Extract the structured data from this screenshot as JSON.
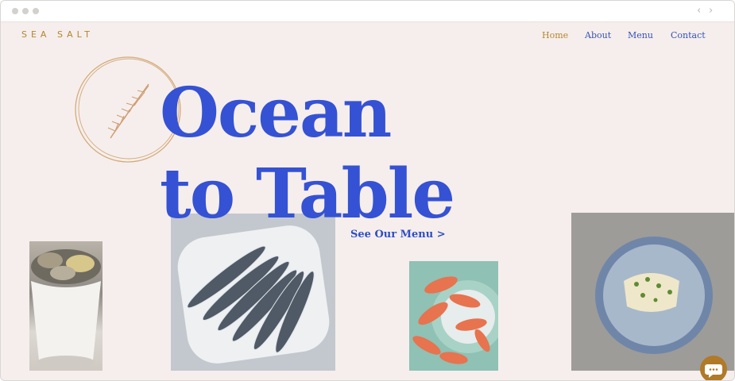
{
  "brand": {
    "logo": "SEA SALT"
  },
  "nav": {
    "items": [
      {
        "label": "Home"
      },
      {
        "label": "About"
      },
      {
        "label": "Menu"
      },
      {
        "label": "Contact"
      }
    ]
  },
  "hero": {
    "line1": "Ocean",
    "line2": "to Table",
    "cta": "See Our Menu >"
  },
  "colors": {
    "accent_gold": "#b3862f",
    "headline_blue": "#3552d4",
    "background": "#f6eeec"
  },
  "icons": [
    "chevron-left-icon",
    "chevron-right-icon",
    "rosemary-sprig-icon",
    "chat-icon"
  ]
}
